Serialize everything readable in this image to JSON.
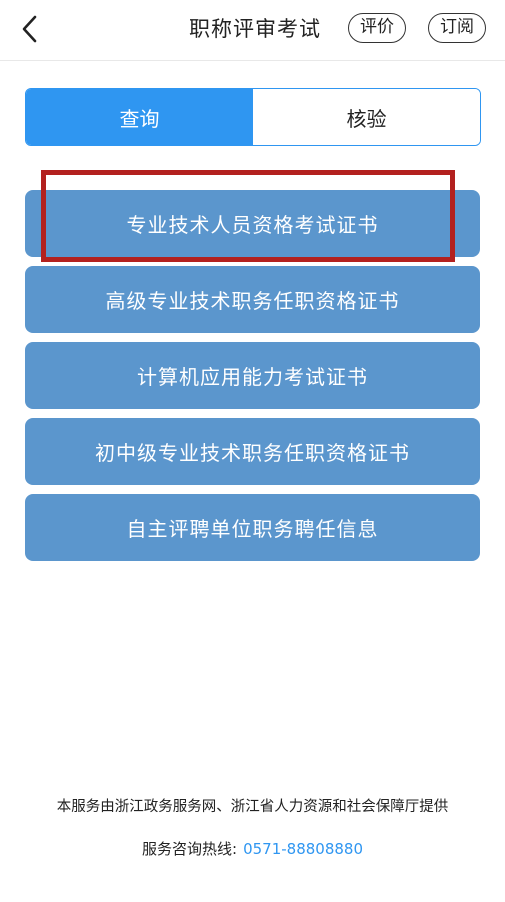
{
  "header": {
    "back_icon": "chevron-left-icon",
    "title": "职称评审考试",
    "evaluate_label": "评价",
    "subscribe_label": "订阅"
  },
  "tabs": [
    {
      "label": "查询",
      "active": true
    },
    {
      "label": "核验",
      "active": false
    }
  ],
  "menu": [
    {
      "label": "专业技术人员资格考试证书",
      "highlighted": true
    },
    {
      "label": "高级专业技术职务任职资格证书"
    },
    {
      "label": "计算机应用能力考试证书"
    },
    {
      "label": "初中级专业技术职务任职资格证书"
    },
    {
      "label": "自主评聘单位职务聘任信息"
    }
  ],
  "footer": {
    "provider_text": "本服务由浙江政务服务网、浙江省人力资源和社会保障厅提供",
    "hotline_label": "服务咨询热线:",
    "hotline_number": "0571-88808880"
  },
  "colors": {
    "accent": "#2f96f1",
    "menu_button": "#5b96cd",
    "highlight_border": "#b3211f"
  }
}
